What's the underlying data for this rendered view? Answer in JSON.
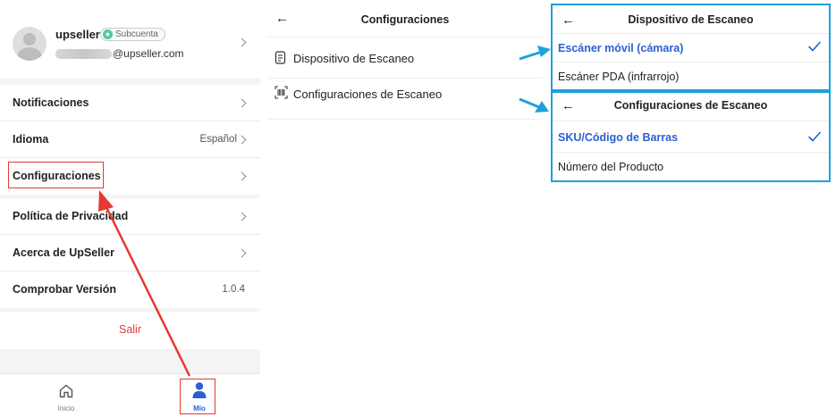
{
  "left_screen": {
    "profile": {
      "username": "upseller",
      "badge_label": "Subcuenta",
      "email_domain": "@upseller.com"
    },
    "menu_group_1": [
      {
        "label": "Notificaciones",
        "value": ""
      },
      {
        "label": "Idioma",
        "value": "Español"
      },
      {
        "label": "Configuraciones",
        "value": ""
      }
    ],
    "menu_group_2": [
      {
        "label": "Política de Privacidad",
        "value": ""
      },
      {
        "label": "Acerca de UpSeller",
        "value": ""
      },
      {
        "label": "Comprobar Versión",
        "value": "1.0.4"
      }
    ],
    "logout_label": "Salir",
    "tabs": [
      {
        "label": "Inicio",
        "icon": "home-icon",
        "active": false
      },
      {
        "label": "Mío",
        "icon": "person-icon",
        "active": true
      }
    ]
  },
  "middle_screen": {
    "title": "Configuraciones",
    "items": [
      {
        "label": "Dispositivo de Escaneo",
        "icon": "device-icon"
      },
      {
        "label": "Configuraciones de Escaneo",
        "icon": "barcode-scan-icon"
      }
    ]
  },
  "scan_device_screen": {
    "title": "Dispositivo de Escaneo",
    "options": [
      {
        "label": "Escáner móvil (cámara)",
        "selected": true
      },
      {
        "label": "Escáner PDA (infrarrojo)",
        "selected": false
      }
    ]
  },
  "scan_settings_screen": {
    "title": "Configuraciones de Escaneo",
    "options": [
      {
        "label": "SKU/Código de Barras",
        "selected": true
      },
      {
        "label": "Número del Producto",
        "selected": false
      }
    ]
  },
  "colors": {
    "accent_blue": "#2a5fd6",
    "highlight_red": "#e53935",
    "callout_blue": "#1ea1dc",
    "logout_red": "#e53935"
  }
}
